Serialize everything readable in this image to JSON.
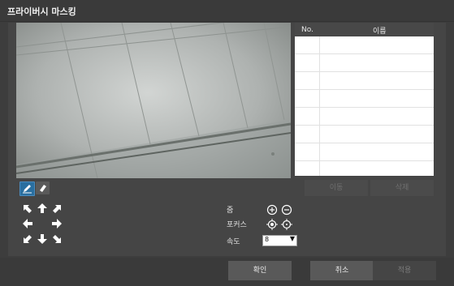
{
  "window": {
    "title": "프라이버시 마스킹"
  },
  "mask_table": {
    "col_no": "No.",
    "col_name": "이름",
    "rows": [
      {},
      {},
      {},
      {},
      {},
      {},
      {},
      {}
    ],
    "move_label": "이동",
    "delete_label": "삭제"
  },
  "tools": {
    "draw_icon": "pencil-icon",
    "erase_icon": "eraser-icon"
  },
  "ptz": {
    "zoom_label": "줌",
    "focus_label": "포커스",
    "speed_label": "속도",
    "speed_value": "8"
  },
  "footer": {
    "ok_label": "확인",
    "cancel_label": "취소",
    "apply_label": "적용"
  }
}
